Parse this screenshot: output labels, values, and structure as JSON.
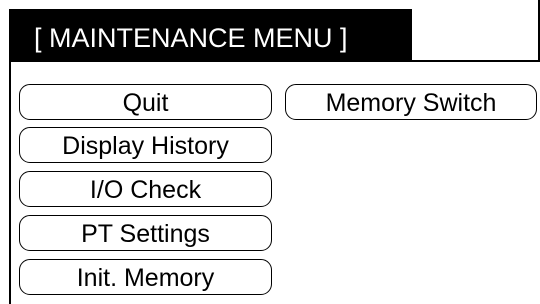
{
  "header": {
    "title": "[ MAINTENANCE MENU ]"
  },
  "menu": {
    "quit": "Quit",
    "memory_switch": "Memory Switch",
    "display_history": "Display History",
    "io_check": "I/O Check",
    "pt_settings": "PT Settings",
    "init_memory": "Init. Memory"
  },
  "colors": {
    "title_background": "#000000",
    "title_text": "#ffffff",
    "button_border": "#000000",
    "background": "#ffffff"
  }
}
